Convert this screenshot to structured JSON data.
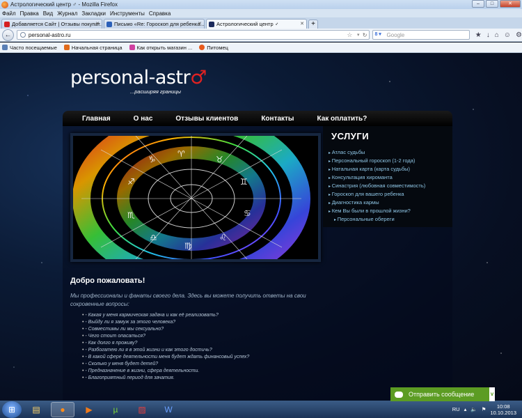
{
  "window": {
    "title": "Астрологический центр ♂ - Mozilla Firefox",
    "controls": [
      "–",
      "□",
      "✕"
    ]
  },
  "menu": [
    "Файл",
    "Правка",
    "Вид",
    "Журнал",
    "Закладки",
    "Инструменты",
    "Справка"
  ],
  "tabs": [
    {
      "label": "Добавляется Сайт | Отзывы покупат...",
      "icon_color": "#d62020"
    },
    {
      "label": "Письмо «Re: Гороскоп для ребенка...",
      "icon_color": "#2b5fb8"
    },
    {
      "label": "Астрологический центр ♂",
      "icon_color": "#1b2a5c",
      "active": true
    }
  ],
  "navbar": {
    "url": "personal-astro.ru",
    "search_placeholder": "Google",
    "search_engine": "8 ▾"
  },
  "bookmarks": [
    {
      "label": "Часто посещаемые",
      "icon_color": "#5a7fb5"
    },
    {
      "label": "Начальная страница",
      "icon_color": "#e06a1b"
    },
    {
      "label": "Как открыть магазин ...",
      "icon_color": "#d040a0"
    },
    {
      "label": "Питомец",
      "icon_color": "#e85a1b"
    }
  ],
  "site": {
    "logo_text": "personal-astr",
    "logo_symbol": "♂",
    "tagline": "...расширяя границы",
    "nav": [
      "Главная",
      "О нас",
      "Отзывы клиентов",
      "Контакты",
      "Как оплатить?"
    ],
    "services_title": "УСЛУГИ",
    "services": [
      "Атлас судьбы",
      "Персональный гороскоп (1-2 года)",
      "Натальная карта (карта судьбы)",
      "Консультация хироманта",
      "Синастрия (любовная совместимость)",
      "Гороскоп для вашего ребенка",
      "Диагностика кармы",
      "Кем Вы были в прошлой жизни?",
      "Персональные обереги"
    ],
    "welcome_title": "Добро пожаловать!",
    "intro": "Мы профессионалы и фанаты своего дела. Здесь вы можете получить ответы на свои сокровенные вопросы:",
    "questions": [
      "- Какая у меня кармическая задача и как её реализовать?",
      "- Выйду ли я замуж за этого человека?",
      "- Совместимы ли мы сексуально?",
      "- Чего стоит опасаться?",
      "- Как долго я проживу?",
      "- Разбогатею ли я в этой жизни и как этого достичь?",
      "- В какой сфере деятельности меня будет ждать финансовый успех?",
      "- Сколько у меня будет детей?",
      "- Предназначение в жизни, сфера деятельности.",
      "- Благоприятный период для зачатия."
    ],
    "chat_label": "Отправить сообщение",
    "chat_badge": "v"
  },
  "taskbar": {
    "lang": "RU",
    "time": "10:08",
    "date": "10.10.2013"
  },
  "colors": {
    "link": "#8fc6e6",
    "accent_red": "#e02222",
    "chat_green": "#5c9c23"
  }
}
